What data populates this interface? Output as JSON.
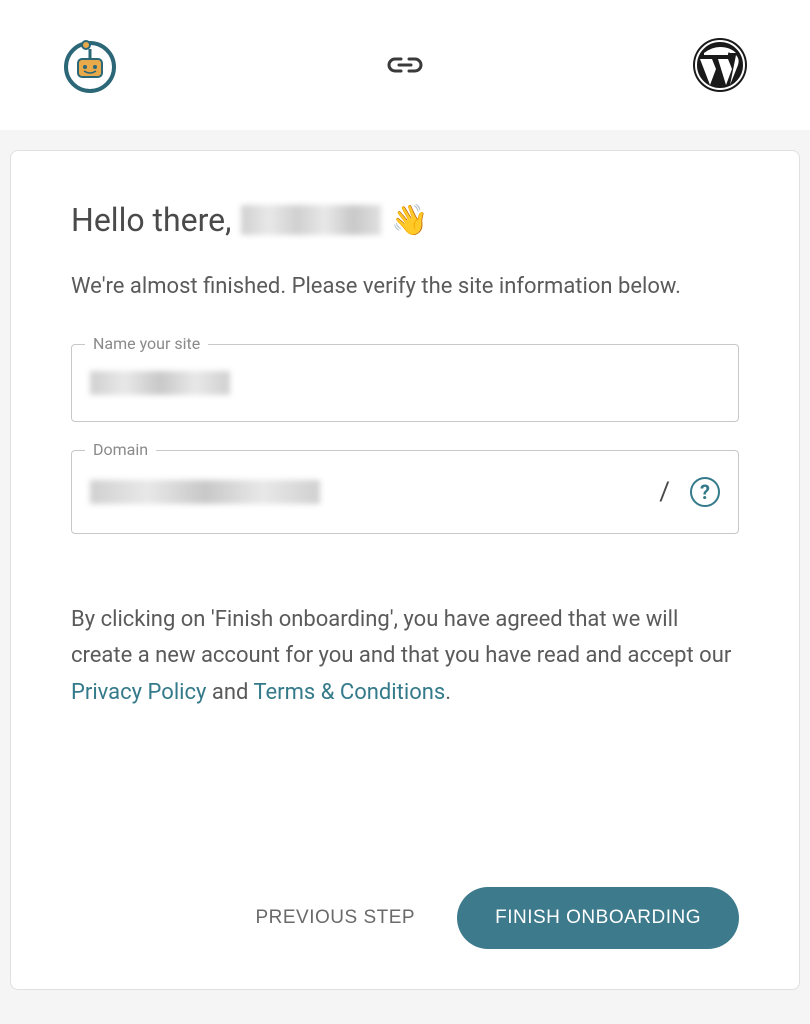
{
  "header": {
    "robot_icon": "robot-logo",
    "link_icon": "link-icon",
    "wordpress_icon": "wordpress-logo"
  },
  "greeting": {
    "prefix": "Hello there,",
    "name": "[redacted]",
    "emoji": "👋"
  },
  "subtitle": "We're almost finished. Please verify the site information below.",
  "fields": {
    "site_name": {
      "label": "Name your site",
      "value": "[redacted]"
    },
    "domain": {
      "label": "Domain",
      "value": "[redacted]",
      "suffix": "/"
    }
  },
  "agreement": {
    "prefix": "By clicking on 'Finish onboarding', you have agreed that we will create a new account for you and that you have read and accept our ",
    "privacy_link": "Privacy Policy",
    "connector": " and ",
    "terms_link": "Terms & Conditions",
    "suffix": "."
  },
  "buttons": {
    "previous": "PREVIOUS STEP",
    "finish": "FINISH ONBOARDING"
  },
  "colors": {
    "primary": "#3d7a8c",
    "text": "#4a4a4a",
    "text_muted": "#5a5a5a",
    "border": "#c8c8c8"
  }
}
